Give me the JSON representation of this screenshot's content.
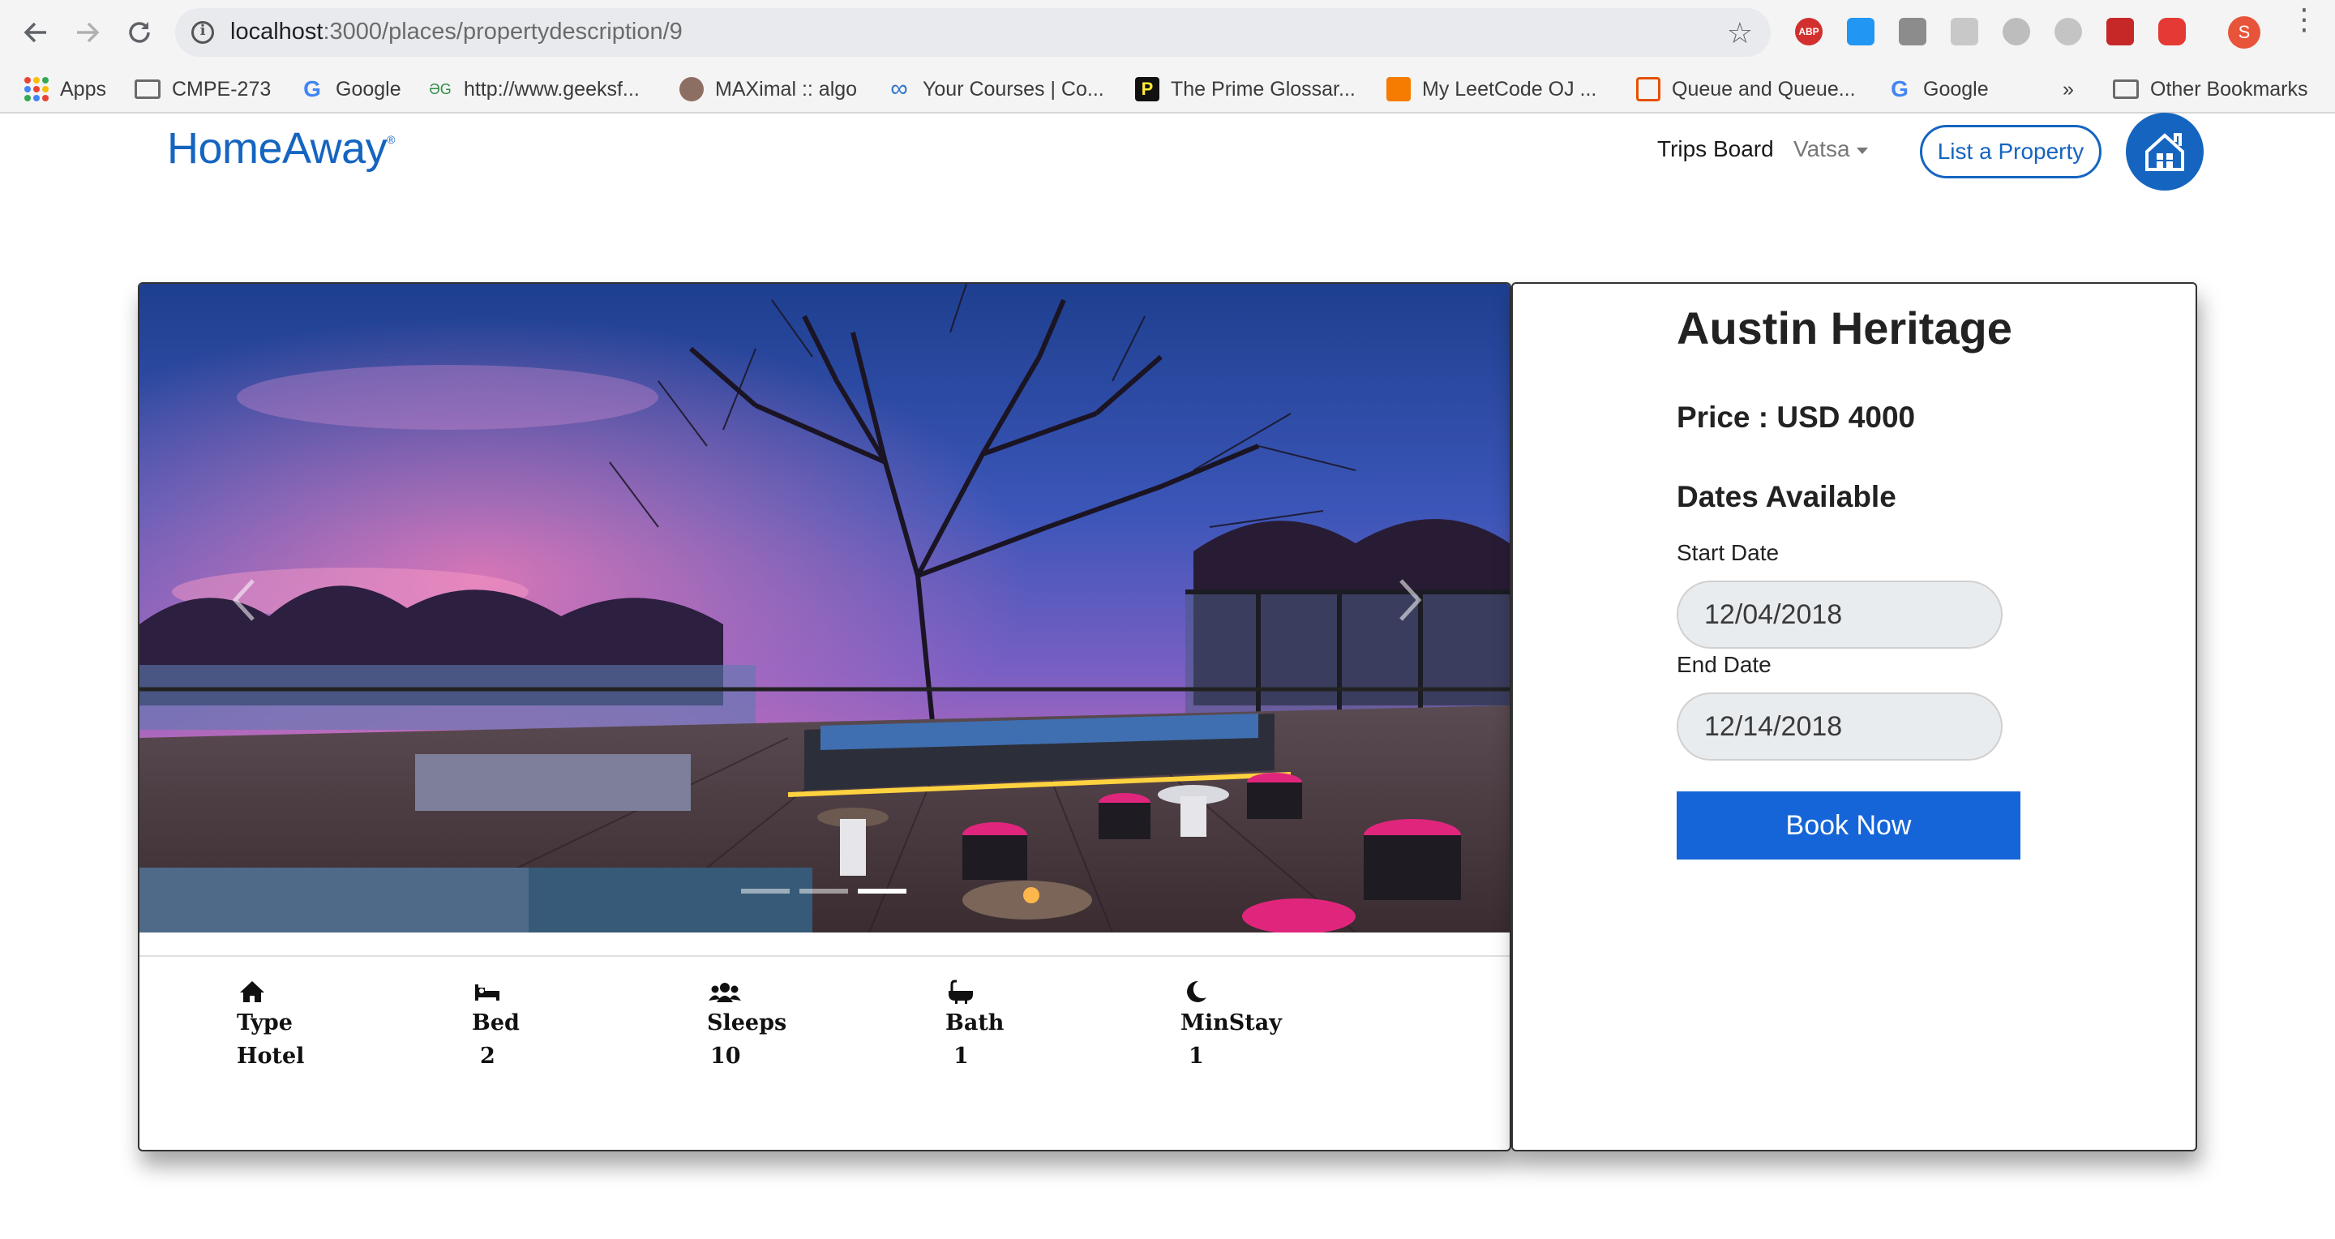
{
  "browser": {
    "url_host": "localhost",
    "url_path": ":3000/places/propertydescription/9",
    "profile_initial": "S",
    "bookmarks": [
      {
        "label": "Apps",
        "icon": "apps-grid-icon"
      },
      {
        "label": "CMPE-273",
        "icon": "folder-icon"
      },
      {
        "label": "Google",
        "icon": "google-icon"
      },
      {
        "label": "http://www.geeksf...",
        "icon": "geeksforgeeks-icon"
      },
      {
        "label": "MAXimal :: algo",
        "icon": "maximal-icon"
      },
      {
        "label": "Your Courses | Co...",
        "icon": "coursera-icon"
      },
      {
        "label": "The Prime Glossar...",
        "icon": "prime-glossary-icon"
      },
      {
        "label": "My LeetCode OJ ...",
        "icon": "blogger-icon"
      },
      {
        "label": "Queue and Queue...",
        "icon": "queue-icon"
      },
      {
        "label": "Google",
        "icon": "google-icon"
      }
    ],
    "overflow_label": "»",
    "other_bookmarks": "Other Bookmarks"
  },
  "header": {
    "logo": "HomeAway",
    "logo_mark": "®",
    "trips_board": "Trips Board",
    "user_name": "Vatsa",
    "list_property": "List a Property"
  },
  "property": {
    "title": "Austin Heritage",
    "price": "Price : USD 4000",
    "dates_heading": "Dates Available",
    "start_label": "Start Date",
    "start_date": "12/04/2018",
    "end_label": "End Date",
    "end_date": "12/14/2018",
    "book_button": "Book Now",
    "carousel_slides": 3,
    "carousel_active_slide": 3,
    "amenities": [
      {
        "label": "Type",
        "value": "Hotel",
        "icon": "home-icon"
      },
      {
        "label": "Bed",
        "value": "2",
        "icon": "bed-icon"
      },
      {
        "label": "Sleeps",
        "value": "10",
        "icon": "users-icon"
      },
      {
        "label": "Bath",
        "value": "1",
        "icon": "bathtub-icon"
      },
      {
        "label": "MinStay",
        "value": "1",
        "icon": "moon-icon"
      }
    ]
  },
  "colors": {
    "brand_blue": "#1565c0",
    "book_button": "#1565d8",
    "input_bg": "#e9ecef"
  }
}
